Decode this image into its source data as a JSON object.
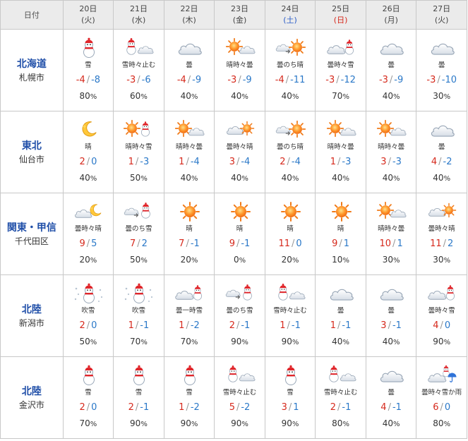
{
  "header": {
    "corner": "日付",
    "days": [
      {
        "date": "20日",
        "weekday": "(火)",
        "type": "weekday"
      },
      {
        "date": "21日",
        "weekday": "(水)",
        "type": "weekday"
      },
      {
        "date": "22日",
        "weekday": "(木)",
        "type": "weekday"
      },
      {
        "date": "23日",
        "weekday": "(金)",
        "type": "weekday"
      },
      {
        "date": "24日",
        "weekday": "(土)",
        "type": "sat"
      },
      {
        "date": "25日",
        "weekday": "(日)",
        "type": "sun"
      },
      {
        "date": "26日",
        "weekday": "(月)",
        "type": "weekday"
      },
      {
        "date": "27日",
        "weekday": "(火)",
        "type": "weekday"
      }
    ]
  },
  "regions": [
    {
      "name": "北海道",
      "city": "札幌市",
      "days": [
        {
          "icon": "snow-icon",
          "weather": "雪",
          "high": "-4",
          "low": "-8",
          "prob": "80"
        },
        {
          "icon": "snow-cloud-icon",
          "weather": "雪時々止む",
          "high": "-3",
          "low": "-6",
          "prob": "60"
        },
        {
          "icon": "cloud-icon",
          "weather": "曇",
          "high": "-4",
          "low": "-9",
          "prob": "40"
        },
        {
          "icon": "sun-cloud-icon",
          "weather": "晴時々曇",
          "high": "-3",
          "low": "-9",
          "prob": "40"
        },
        {
          "icon": "cloud-then-sun-icon",
          "weather": "曇のち晴",
          "high": "-4",
          "low": "-11",
          "prob": "40"
        },
        {
          "icon": "cloud-snow-icon",
          "weather": "曇時々雪",
          "high": "-3",
          "low": "-12",
          "prob": "70"
        },
        {
          "icon": "cloud-icon",
          "weather": "曇",
          "high": "-3",
          "low": "-9",
          "prob": "40"
        },
        {
          "icon": "cloud-icon",
          "weather": "曇",
          "high": "-3",
          "low": "-10",
          "prob": "30"
        }
      ]
    },
    {
      "name": "東北",
      "city": "仙台市",
      "days": [
        {
          "icon": "moon-icon",
          "weather": "晴",
          "high": "2",
          "low": "0",
          "prob": "40"
        },
        {
          "icon": "sun-snow-icon",
          "weather": "晴時々雪",
          "high": "1",
          "low": "-3",
          "prob": "50"
        },
        {
          "icon": "sun-cloud-icon",
          "weather": "晴時々曇",
          "high": "1",
          "low": "-4",
          "prob": "40"
        },
        {
          "icon": "cloud-sun-icon",
          "weather": "曇時々晴",
          "high": "3",
          "low": "-4",
          "prob": "40"
        },
        {
          "icon": "cloud-then-sun-icon",
          "weather": "曇のち晴",
          "high": "2",
          "low": "-4",
          "prob": "40"
        },
        {
          "icon": "sun-cloud-icon",
          "weather": "晴時々曇",
          "high": "1",
          "low": "-3",
          "prob": "40"
        },
        {
          "icon": "sun-cloud-icon",
          "weather": "晴時々曇",
          "high": "3",
          "low": "-3",
          "prob": "40"
        },
        {
          "icon": "cloud-icon",
          "weather": "曇",
          "high": "4",
          "low": "-2",
          "prob": "40"
        }
      ]
    },
    {
      "name": "関東・甲信",
      "city": "千代田区",
      "days": [
        {
          "icon": "cloud-moon-icon",
          "weather": "曇時々晴",
          "high": "9",
          "low": "5",
          "prob": "20"
        },
        {
          "icon": "cloud-then-snow-icon",
          "weather": "曇のち雪",
          "high": "7",
          "low": "2",
          "prob": "50"
        },
        {
          "icon": "sun-icon",
          "weather": "晴",
          "high": "7",
          "low": "-1",
          "prob": "20"
        },
        {
          "icon": "sun-icon",
          "weather": "晴",
          "high": "9",
          "low": "-1",
          "prob": "0"
        },
        {
          "icon": "sun-icon",
          "weather": "晴",
          "high": "11",
          "low": "0",
          "prob": "20"
        },
        {
          "icon": "sun-icon",
          "weather": "晴",
          "high": "9",
          "low": "1",
          "prob": "10"
        },
        {
          "icon": "sun-cloud-icon",
          "weather": "晴時々曇",
          "high": "10",
          "low": "1",
          "prob": "30"
        },
        {
          "icon": "cloud-sun-icon",
          "weather": "曇時々晴",
          "high": "11",
          "low": "2",
          "prob": "30"
        }
      ]
    },
    {
      "name": "北陸",
      "city": "新潟市",
      "days": [
        {
          "icon": "blizzard-icon",
          "weather": "吹雪",
          "high": "2",
          "low": "0",
          "prob": "50"
        },
        {
          "icon": "blizzard-icon",
          "weather": "吹雪",
          "high": "1",
          "low": "-1",
          "prob": "70"
        },
        {
          "icon": "cloud-snow-icon",
          "weather": "曇一時雪",
          "high": "1",
          "low": "-2",
          "prob": "70"
        },
        {
          "icon": "cloud-then-snow-icon",
          "weather": "曇のち雪",
          "high": "2",
          "low": "-1",
          "prob": "90"
        },
        {
          "icon": "snow-cloud-icon",
          "weather": "雪時々止む",
          "high": "1",
          "low": "-1",
          "prob": "90"
        },
        {
          "icon": "cloud-icon",
          "weather": "曇",
          "high": "1",
          "low": "-1",
          "prob": "40"
        },
        {
          "icon": "cloud-icon",
          "weather": "曇",
          "high": "3",
          "low": "-1",
          "prob": "40"
        },
        {
          "icon": "cloud-snow-icon",
          "weather": "曇時々雪",
          "high": "4",
          "low": "0",
          "prob": "90"
        }
      ]
    },
    {
      "name": "北陸",
      "city": "金沢市",
      "days": [
        {
          "icon": "snow-icon",
          "weather": "雪",
          "high": "2",
          "low": "0",
          "prob": "70"
        },
        {
          "icon": "snow-icon",
          "weather": "雪",
          "high": "2",
          "low": "-1",
          "prob": "90"
        },
        {
          "icon": "snow-icon",
          "weather": "雪",
          "high": "1",
          "low": "-2",
          "prob": "90"
        },
        {
          "icon": "snow-cloud-icon",
          "weather": "雪時々止む",
          "high": "5",
          "low": "-2",
          "prob": "90"
        },
        {
          "icon": "snow-icon",
          "weather": "雪",
          "high": "3",
          "low": "1",
          "prob": "90"
        },
        {
          "icon": "snow-cloud-icon",
          "weather": "雪時々止む",
          "high": "2",
          "low": "-1",
          "prob": "80"
        },
        {
          "icon": "cloud-icon",
          "weather": "曇",
          "high": "4",
          "low": "-1",
          "prob": "40"
        },
        {
          "icon": "cloud-snow-rain-icon",
          "weather": "曇時々雪か雨",
          "high": "6",
          "low": "0",
          "prob": "80"
        }
      ]
    }
  ],
  "units": {
    "temp_sep": "/",
    "percent": "%"
  },
  "colors": {
    "high": "#d6291c",
    "low": "#2a78c8",
    "region": "#1f4ea8",
    "header_bg": "#ebebeb",
    "saturday": "#2a5cc8",
    "sunday": "#d6291c"
  }
}
